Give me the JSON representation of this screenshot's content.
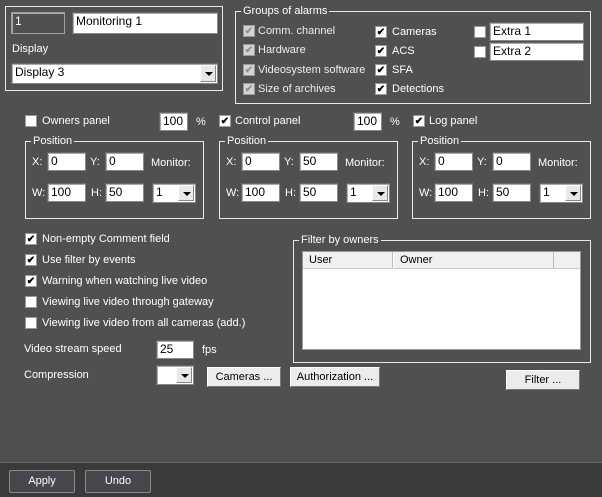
{
  "monitor": {
    "number": "1",
    "name": "Monitoring 1",
    "display_label": "Display",
    "display_value": "Display 3"
  },
  "alarms": {
    "title": "Groups of alarms",
    "items": [
      {
        "label": "Comm. channel",
        "checked": true,
        "disabled": true
      },
      {
        "label": "Hardware",
        "checked": true,
        "disabled": true
      },
      {
        "label": "Videosystem software",
        "checked": true,
        "disabled": true
      },
      {
        "label": "Size of archives",
        "checked": true,
        "disabled": true
      },
      {
        "label": "Cameras",
        "checked": true
      },
      {
        "label": "ACS",
        "checked": true
      },
      {
        "label": "SFA",
        "checked": true
      },
      {
        "label": "Detections",
        "checked": true
      }
    ],
    "extra": [
      {
        "value": "Extra 1",
        "checked": false
      },
      {
        "value": "Extra 2",
        "checked": false
      }
    ]
  },
  "panels": [
    {
      "label": "Owners panel",
      "checked": false,
      "percent": "100",
      "unit": "%",
      "position_title": "Position",
      "x": "0",
      "y": "0",
      "w": "100",
      "h": "50",
      "monitor": "1"
    },
    {
      "label": "Control panel",
      "checked": true,
      "percent": "100",
      "unit": "%",
      "position_title": "Position",
      "x": "0",
      "y": "50",
      "w": "100",
      "h": "50",
      "monitor": "1"
    },
    {
      "label": "Log panel",
      "checked": true,
      "position_title": "Position",
      "x": "0",
      "y": "0",
      "w": "100",
      "h": "50",
      "monitor": "1"
    }
  ],
  "pos_labels": {
    "x": "X:",
    "y": "Y:",
    "w": "W:",
    "h": "H:",
    "monitor": "Monitor:"
  },
  "options": [
    {
      "label": "Non-empty Comment field",
      "checked": true
    },
    {
      "label": "Use filter by events",
      "checked": true
    },
    {
      "label": "Warning when watching live video",
      "checked": true
    },
    {
      "label": "Viewing live video through gateway",
      "checked": false
    },
    {
      "label": "Viewing live video from all cameras (add.)",
      "checked": false
    }
  ],
  "stream": {
    "label": "Video stream speed",
    "value": "25",
    "unit": "fps"
  },
  "compression": {
    "label": "Compression",
    "value": ""
  },
  "buttons": {
    "cameras": "Cameras ...",
    "authorization": "Authorization ...",
    "filter": "Filter ...",
    "apply": "Apply",
    "undo": "Undo"
  },
  "owners": {
    "title": "Filter by owners",
    "columns": [
      "User",
      "Owner"
    ]
  }
}
